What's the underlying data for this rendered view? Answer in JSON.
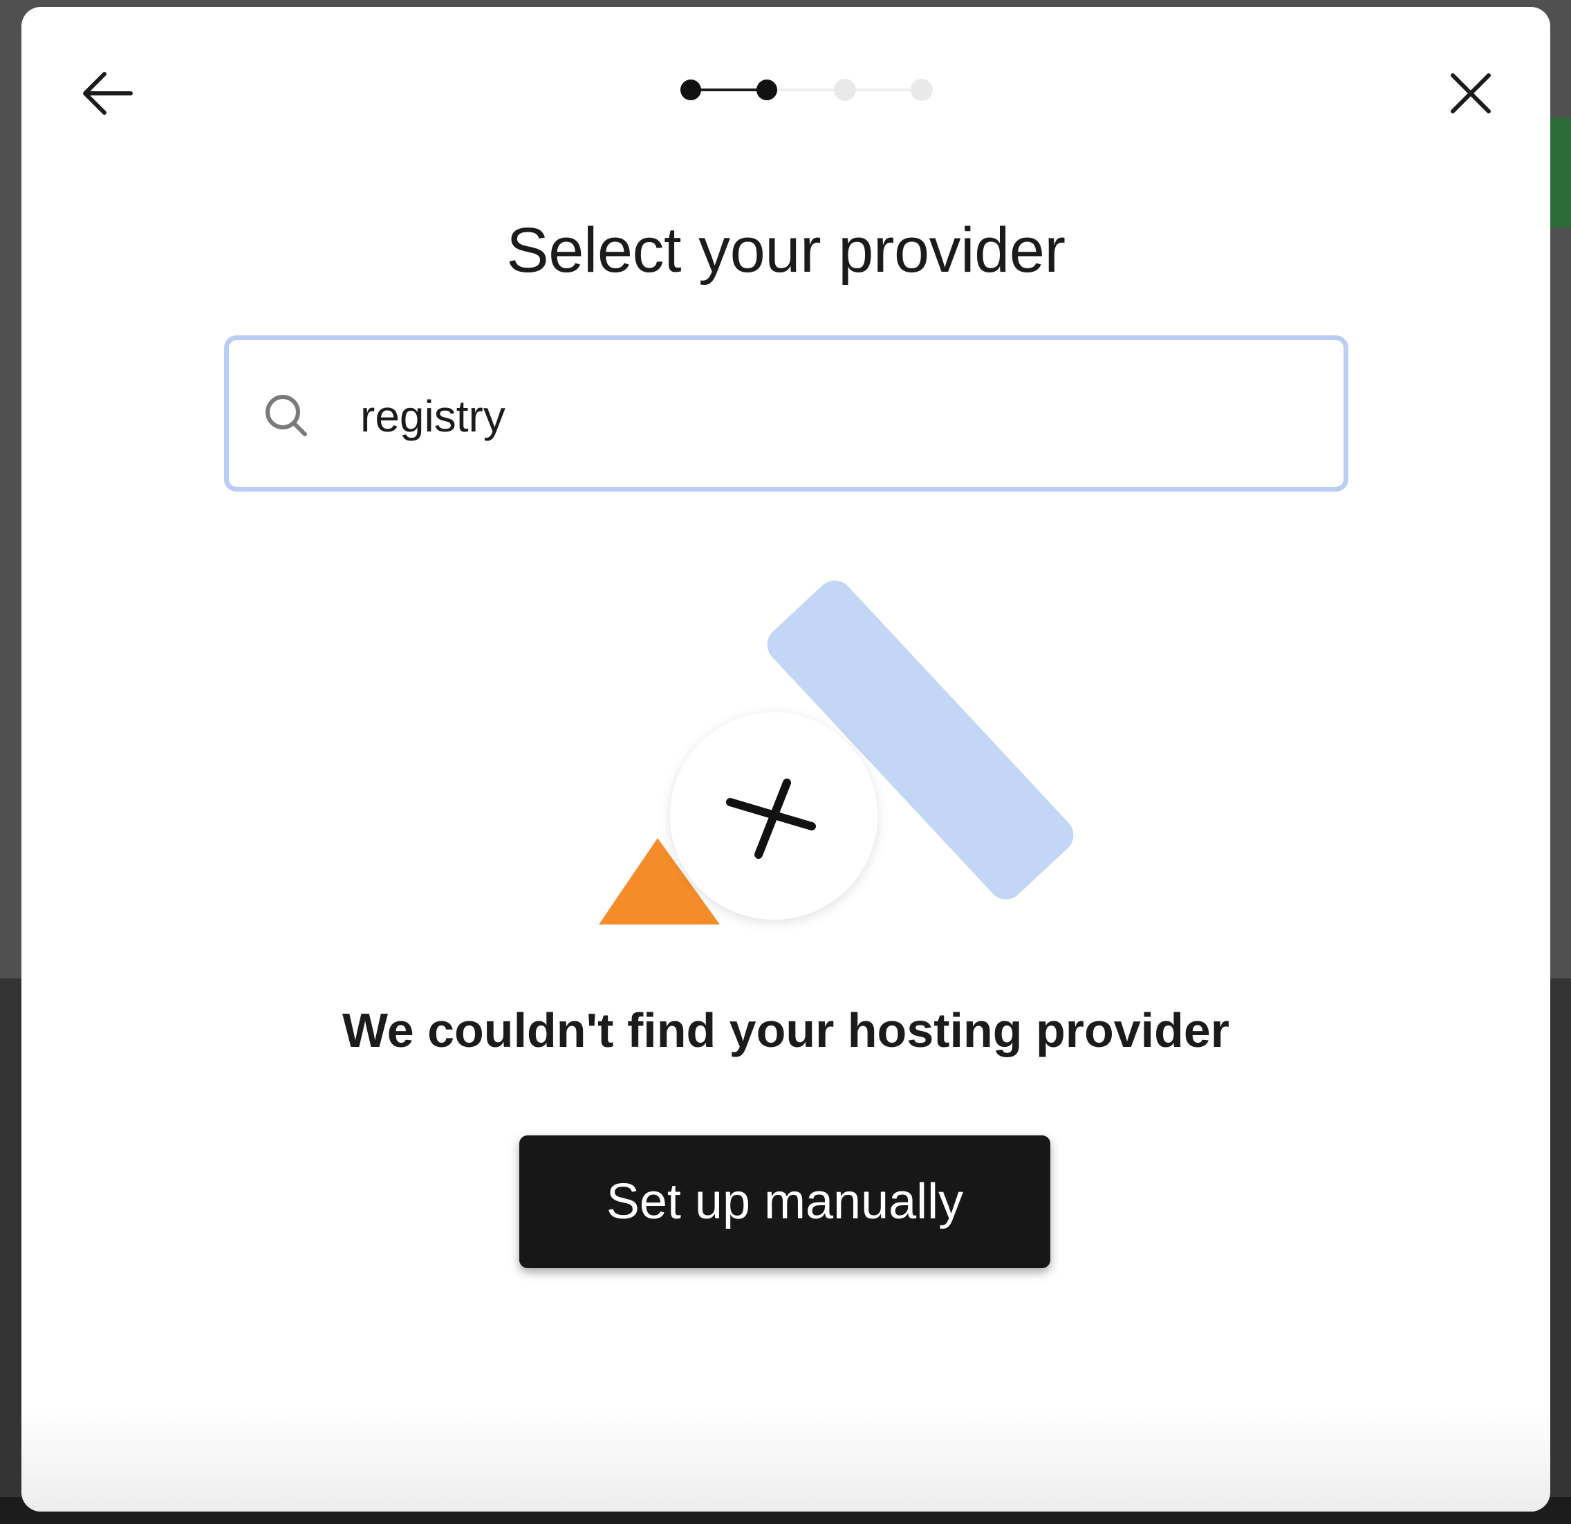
{
  "stepper": {
    "total_steps": 4,
    "current_step": 2
  },
  "header": {
    "back_icon": "arrow-left-icon",
    "close_icon": "close-icon"
  },
  "title": "Select your provider",
  "search": {
    "value": "registry",
    "icon": "search-icon"
  },
  "empty_state": {
    "illustration": "provider-not-found-illustration",
    "message": "We couldn't find your hosting provider"
  },
  "actions": {
    "manual_label": "Set up manually"
  },
  "colors": {
    "modal_bg": "#ffffff",
    "search_border": "#b9cdf5",
    "button_bg": "#171717",
    "illustration_blue": "#c3d6f5",
    "illustration_orange": "#f58c2a",
    "step_active": "#111111",
    "step_inactive": "#e9e9e9"
  }
}
